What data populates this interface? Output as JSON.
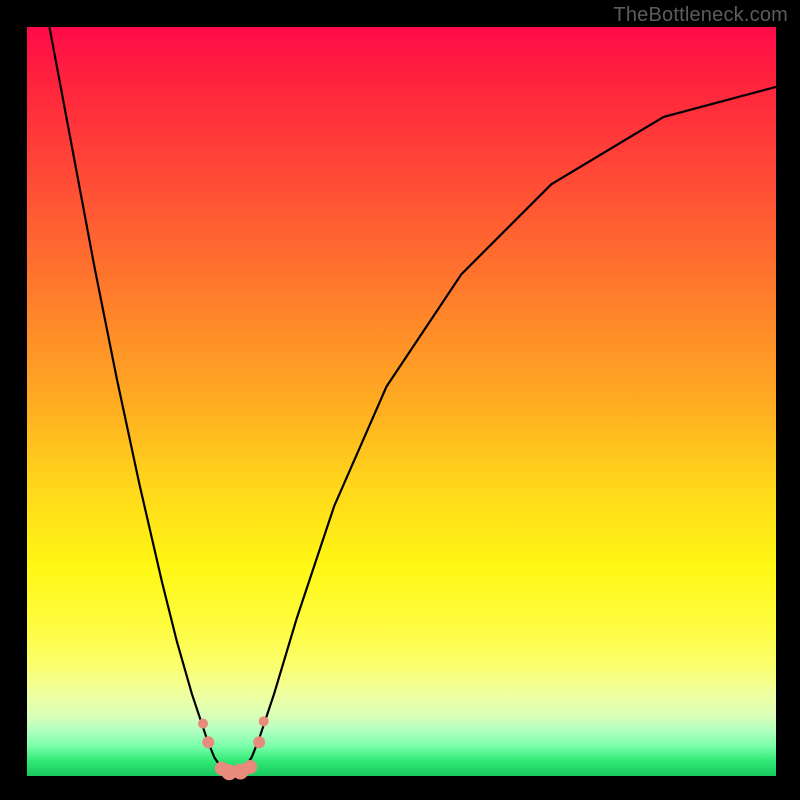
{
  "watermark": "TheBottleneck.com",
  "colors": {
    "frame_bg": "#000000",
    "gradient_top": "#ff0a4a",
    "gradient_mid": "#fff714",
    "gradient_bottom": "#17c95e",
    "curve": "#000000",
    "markers": "#e88a7c"
  },
  "chart_data": {
    "type": "line",
    "title": "",
    "xlabel": "",
    "ylabel": "",
    "xlim": [
      0,
      100
    ],
    "ylim": [
      0,
      100
    ],
    "notes": "V-shaped bottleneck curve; y=score (0=best, 100=worst). Minimum of curve sits near x≈27 and touches y≈0. Pink markers cluster near the trough.",
    "curve": {
      "x": [
        3,
        6,
        9,
        12,
        15,
        18,
        20,
        22,
        24,
        25,
        26,
        27,
        28,
        29,
        30,
        31,
        33,
        36,
        41,
        48,
        58,
        70,
        85,
        100
      ],
      "y": [
        100,
        84,
        68,
        53,
        39,
        26,
        18,
        11,
        5,
        2.5,
        1,
        0.4,
        0.4,
        1,
        2.5,
        5,
        11,
        21,
        36,
        52,
        67,
        79,
        88,
        92
      ]
    },
    "markers": [
      {
        "x": 23.5,
        "y": 7,
        "r": 5
      },
      {
        "x": 24.2,
        "y": 4.5,
        "r": 6
      },
      {
        "x": 26.0,
        "y": 1.0,
        "r": 7
      },
      {
        "x": 27.0,
        "y": 0.5,
        "r": 8
      },
      {
        "x": 28.5,
        "y": 0.6,
        "r": 8
      },
      {
        "x": 29.8,
        "y": 1.2,
        "r": 7
      },
      {
        "x": 31.0,
        "y": 4.5,
        "r": 6
      },
      {
        "x": 31.6,
        "y": 7.3,
        "r": 5
      }
    ]
  }
}
